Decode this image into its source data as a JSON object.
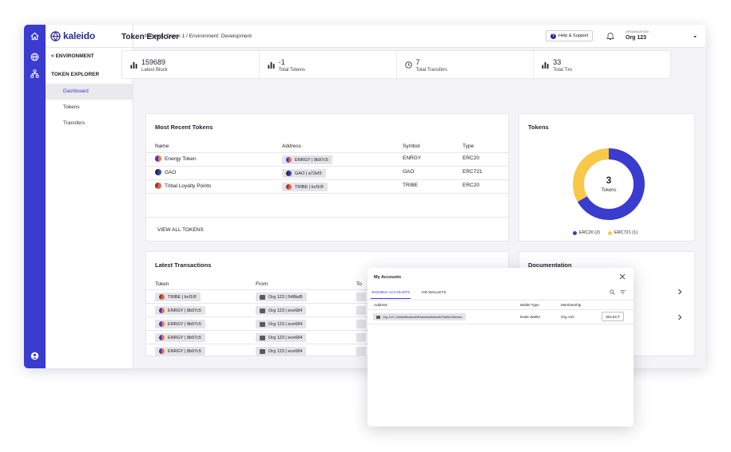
{
  "brand": {
    "name": "kaleido"
  },
  "nav": {
    "back_label": "< ENVIRONMENT",
    "section_label": "TOKEN EXPLORER",
    "items": [
      {
        "label": "Dashboard",
        "active": true
      },
      {
        "label": "Tokens",
        "active": false
      },
      {
        "label": "Transfers",
        "active": false
      }
    ]
  },
  "topbar": {
    "breadcrumb": "Network: Demo 1  /  Environment: Development",
    "help_label": "Help & Support",
    "org_label": "ORGANIZATION",
    "org_name": "Org 123"
  },
  "page": {
    "title": "Token Explorer"
  },
  "stats": [
    {
      "value": "159689",
      "label": "Latest Block",
      "icon": "bar-chart-icon"
    },
    {
      "value": "-1",
      "label": "Total Tokens",
      "icon": "bar-chart-icon"
    },
    {
      "value": "7",
      "label": "Total Transfers",
      "icon": "clock-icon"
    },
    {
      "value": "33",
      "label": "Total Txs",
      "icon": "bar-chart-icon"
    }
  ],
  "recent_tokens": {
    "title": "Most Recent Tokens",
    "columns": [
      "Name",
      "Address",
      "Symbol",
      "Type"
    ],
    "rows": [
      {
        "name": "Energy Token",
        "address": "ENRGY  |  8b97c5",
        "symbol": "ENRGY",
        "type": "ERC20"
      },
      {
        "name": "GAO",
        "address": "GAO  |  a72ef3",
        "symbol": "GAO",
        "type": "ERC721"
      },
      {
        "name": "Tribal Loyalty Points",
        "address": "TRIBE  |  bcf10f",
        "symbol": "TRIBE",
        "type": "ERC20"
      }
    ],
    "view_all": "VIEW ALL TOKENS"
  },
  "tokens_card": {
    "title": "Tokens",
    "count": "3",
    "count_label": "Tokens",
    "legend": [
      {
        "label": "ERC20 (2)",
        "color": "#3a3bcf"
      },
      {
        "label": "ERC721 (1)",
        "color": "#f7c948"
      }
    ]
  },
  "chart_data": {
    "type": "pie",
    "categories": [
      "ERC20",
      "ERC721"
    ],
    "values": [
      2,
      1
    ],
    "colors": [
      "#3a3bcf",
      "#f7c948"
    ],
    "title": "Tokens"
  },
  "transactions": {
    "title": "Latest Transactions",
    "columns": [
      "Token",
      "From",
      "To"
    ],
    "rows": [
      {
        "token": "TRIBE  |  bcf10f",
        "from": "Org 123  |  548bd5"
      },
      {
        "token": "ENRGY  |  8b97c5",
        "from": "Org 123  |  ece684"
      },
      {
        "token": "ENRGY  |  8b97c5",
        "from": "Org 123  |  ece684"
      },
      {
        "token": "ENRGY  |  8b97c5",
        "from": "Org 123  |  ece684"
      },
      {
        "token": "ENRGY  |  8b97c5",
        "from": "Org 123  |  ece684"
      }
    ]
  },
  "documentation": {
    "title": "Documentation"
  },
  "modal": {
    "title": "My Accounts",
    "tabs": [
      "SIGNING ACCOUNTS",
      "HD WALLETS"
    ],
    "columns": [
      "Address",
      "Wallet Type",
      "Membership"
    ],
    "row": {
      "address": "Org 123  |  0xbfa2ffea6e4b9f1abe6a9b4ed9d75a5d135eefcc",
      "wallet_type": "Node Wallet",
      "membership": "Org 123",
      "action": "SELECT"
    }
  },
  "colors": {
    "accent": "#3a3bcf",
    "secondary": "#f7c948",
    "token_energy": "#ff7043",
    "token_gao": "#3a3bcf",
    "token_tribe": "#e8604c"
  }
}
